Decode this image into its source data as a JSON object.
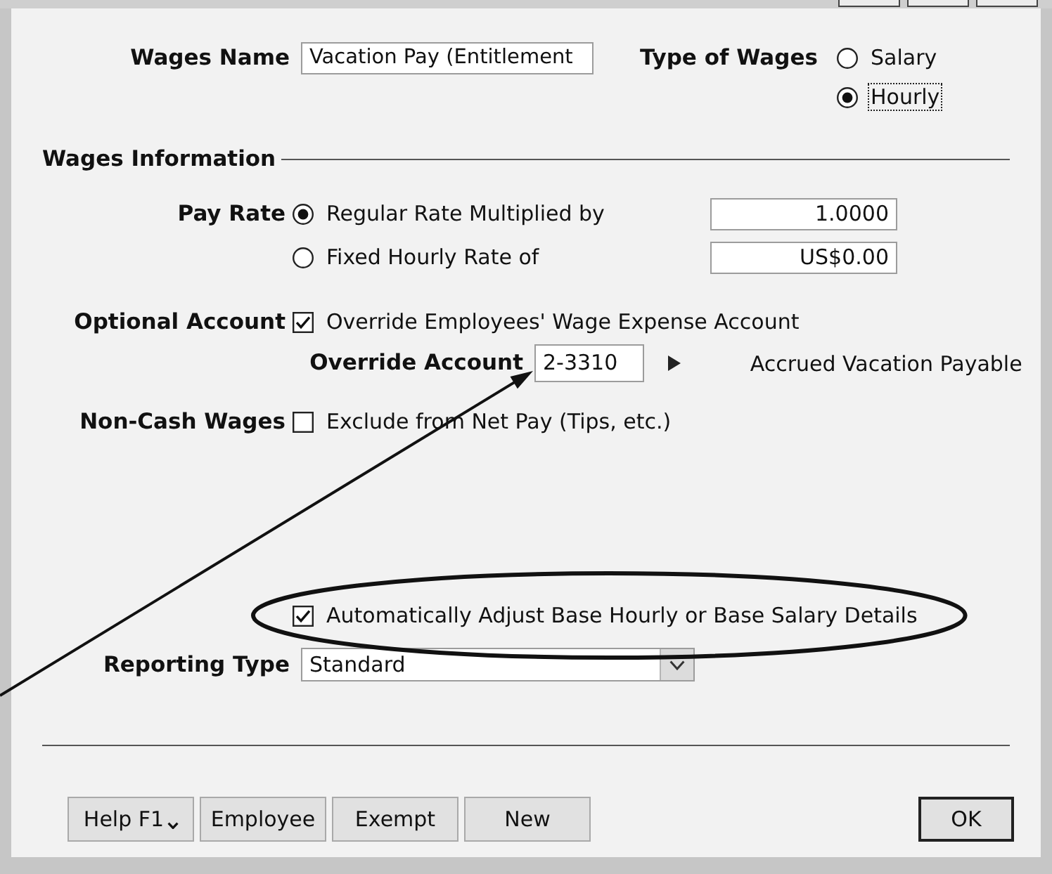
{
  "header": {
    "wages_name": {
      "label": "Wages Name",
      "value": "Vacation Pay (Entitlement"
    },
    "type_of_wages": {
      "label": "Type of Wages",
      "options": [
        {
          "label": "Salary",
          "selected": false,
          "focused": false
        },
        {
          "label": "Hourly",
          "selected": true,
          "focused": true
        }
      ]
    }
  },
  "wages_information": {
    "title": "Wages Information",
    "pay_rate": {
      "label": "Pay Rate",
      "options": [
        {
          "label": "Regular Rate Multiplied by",
          "selected": true,
          "value": "1.0000"
        },
        {
          "label": "Fixed Hourly Rate of",
          "selected": false,
          "value": "US$0.00"
        }
      ]
    },
    "optional_account": {
      "label": "Optional Account",
      "checkbox": {
        "label": "Override Employees' Wage Expense Account",
        "checked": true
      },
      "override_account": {
        "label": "Override Account",
        "value": "2-3310",
        "account_name": "Accrued Vacation Payable",
        "annotation": {
          "kind": "arrow"
        }
      }
    },
    "non_cash_wages": {
      "label": "Non-Cash Wages",
      "checkbox": {
        "label": "Exclude from Net Pay (Tips, etc.)",
        "checked": false
      }
    },
    "auto_adjust": {
      "label": "Automatically Adjust Base Hourly or Base Salary Details",
      "checked": true,
      "annotation": {
        "kind": "ellipse"
      }
    },
    "reporting_type": {
      "label": "Reporting Type",
      "value": "Standard"
    }
  },
  "buttons": [
    {
      "label": "Help F1",
      "kind": "menu"
    },
    {
      "label": "Employee",
      "kind": "plain"
    },
    {
      "label": "Exempt",
      "kind": "plain"
    },
    {
      "label": "New",
      "kind": "plain"
    },
    {
      "label": "OK",
      "kind": "default"
    }
  ]
}
